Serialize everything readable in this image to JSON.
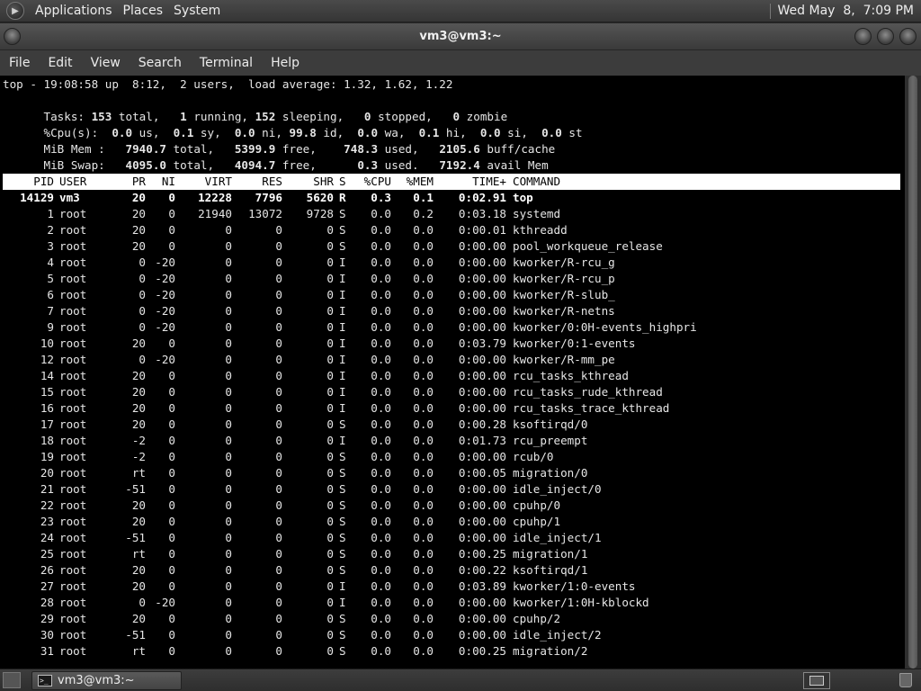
{
  "top_panel": {
    "menus": [
      "Applications",
      "Places",
      "System"
    ],
    "clock": "Wed May  8,  7:09 PM"
  },
  "window": {
    "title": "vm3@vm3:~",
    "menubar": [
      "File",
      "Edit",
      "View",
      "Search",
      "Terminal",
      "Help"
    ]
  },
  "summary": {
    "line1": "top - 19:08:58 up  8:12,  2 users,  load average: 1.32, 1.62, 1.22",
    "tasks": [
      "Tasks: ",
      "153",
      " total,   ",
      "1",
      " running, ",
      "152",
      " sleeping,   ",
      "0",
      " stopped,   ",
      "0",
      " zombie"
    ],
    "cpu": [
      "%Cpu(s):  ",
      "0.0",
      " us,  ",
      "0.1",
      " sy,  ",
      "0.0",
      " ni, ",
      "99.8",
      " id,  ",
      "0.0",
      " wa,  ",
      "0.1",
      " hi,  ",
      "0.0",
      " si,  ",
      "0.0",
      " st"
    ],
    "mem": [
      "MiB Mem :   ",
      "7940.7",
      " total,   ",
      "5399.9",
      " free,    ",
      "748.3",
      " used,   ",
      "2105.6",
      " buff/cache"
    ],
    "swap": [
      "MiB Swap:   ",
      "4095.0",
      " total,   ",
      "4094.7",
      " free,      ",
      "0.3",
      " used.   ",
      "7192.4",
      " avail Mem"
    ]
  },
  "columns": [
    "PID",
    "USER",
    "PR",
    "NI",
    "VIRT",
    "RES",
    "SHR",
    "S",
    "%CPU",
    "%MEM",
    "TIME+",
    "COMMAND"
  ],
  "processes": [
    [
      "14129",
      "vm3",
      "20",
      "0",
      "12228",
      "7796",
      "5620",
      "R",
      "0.3",
      "0.1",
      "0:02.91",
      "top"
    ],
    [
      "1",
      "root",
      "20",
      "0",
      "21940",
      "13072",
      "9728",
      "S",
      "0.0",
      "0.2",
      "0:03.18",
      "systemd"
    ],
    [
      "2",
      "root",
      "20",
      "0",
      "0",
      "0",
      "0",
      "S",
      "0.0",
      "0.0",
      "0:00.01",
      "kthreadd"
    ],
    [
      "3",
      "root",
      "20",
      "0",
      "0",
      "0",
      "0",
      "S",
      "0.0",
      "0.0",
      "0:00.00",
      "pool_workqueue_release"
    ],
    [
      "4",
      "root",
      "0",
      "-20",
      "0",
      "0",
      "0",
      "I",
      "0.0",
      "0.0",
      "0:00.00",
      "kworker/R-rcu_g"
    ],
    [
      "5",
      "root",
      "0",
      "-20",
      "0",
      "0",
      "0",
      "I",
      "0.0",
      "0.0",
      "0:00.00",
      "kworker/R-rcu_p"
    ],
    [
      "6",
      "root",
      "0",
      "-20",
      "0",
      "0",
      "0",
      "I",
      "0.0",
      "0.0",
      "0:00.00",
      "kworker/R-slub_"
    ],
    [
      "7",
      "root",
      "0",
      "-20",
      "0",
      "0",
      "0",
      "I",
      "0.0",
      "0.0",
      "0:00.00",
      "kworker/R-netns"
    ],
    [
      "9",
      "root",
      "0",
      "-20",
      "0",
      "0",
      "0",
      "I",
      "0.0",
      "0.0",
      "0:00.00",
      "kworker/0:0H-events_highpri"
    ],
    [
      "10",
      "root",
      "20",
      "0",
      "0",
      "0",
      "0",
      "I",
      "0.0",
      "0.0",
      "0:03.79",
      "kworker/0:1-events"
    ],
    [
      "12",
      "root",
      "0",
      "-20",
      "0",
      "0",
      "0",
      "I",
      "0.0",
      "0.0",
      "0:00.00",
      "kworker/R-mm_pe"
    ],
    [
      "14",
      "root",
      "20",
      "0",
      "0",
      "0",
      "0",
      "I",
      "0.0",
      "0.0",
      "0:00.00",
      "rcu_tasks_kthread"
    ],
    [
      "15",
      "root",
      "20",
      "0",
      "0",
      "0",
      "0",
      "I",
      "0.0",
      "0.0",
      "0:00.00",
      "rcu_tasks_rude_kthread"
    ],
    [
      "16",
      "root",
      "20",
      "0",
      "0",
      "0",
      "0",
      "I",
      "0.0",
      "0.0",
      "0:00.00",
      "rcu_tasks_trace_kthread"
    ],
    [
      "17",
      "root",
      "20",
      "0",
      "0",
      "0",
      "0",
      "S",
      "0.0",
      "0.0",
      "0:00.28",
      "ksoftirqd/0"
    ],
    [
      "18",
      "root",
      "-2",
      "0",
      "0",
      "0",
      "0",
      "I",
      "0.0",
      "0.0",
      "0:01.73",
      "rcu_preempt"
    ],
    [
      "19",
      "root",
      "-2",
      "0",
      "0",
      "0",
      "0",
      "S",
      "0.0",
      "0.0",
      "0:00.00",
      "rcub/0"
    ],
    [
      "20",
      "root",
      "rt",
      "0",
      "0",
      "0",
      "0",
      "S",
      "0.0",
      "0.0",
      "0:00.05",
      "migration/0"
    ],
    [
      "21",
      "root",
      "-51",
      "0",
      "0",
      "0",
      "0",
      "S",
      "0.0",
      "0.0",
      "0:00.00",
      "idle_inject/0"
    ],
    [
      "22",
      "root",
      "20",
      "0",
      "0",
      "0",
      "0",
      "S",
      "0.0",
      "0.0",
      "0:00.00",
      "cpuhp/0"
    ],
    [
      "23",
      "root",
      "20",
      "0",
      "0",
      "0",
      "0",
      "S",
      "0.0",
      "0.0",
      "0:00.00",
      "cpuhp/1"
    ],
    [
      "24",
      "root",
      "-51",
      "0",
      "0",
      "0",
      "0",
      "S",
      "0.0",
      "0.0",
      "0:00.00",
      "idle_inject/1"
    ],
    [
      "25",
      "root",
      "rt",
      "0",
      "0",
      "0",
      "0",
      "S",
      "0.0",
      "0.0",
      "0:00.25",
      "migration/1"
    ],
    [
      "26",
      "root",
      "20",
      "0",
      "0",
      "0",
      "0",
      "S",
      "0.0",
      "0.0",
      "0:00.22",
      "ksoftirqd/1"
    ],
    [
      "27",
      "root",
      "20",
      "0",
      "0",
      "0",
      "0",
      "I",
      "0.0",
      "0.0",
      "0:03.89",
      "kworker/1:0-events"
    ],
    [
      "28",
      "root",
      "0",
      "-20",
      "0",
      "0",
      "0",
      "I",
      "0.0",
      "0.0",
      "0:00.00",
      "kworker/1:0H-kblockd"
    ],
    [
      "29",
      "root",
      "20",
      "0",
      "0",
      "0",
      "0",
      "S",
      "0.0",
      "0.0",
      "0:00.00",
      "cpuhp/2"
    ],
    [
      "30",
      "root",
      "-51",
      "0",
      "0",
      "0",
      "0",
      "S",
      "0.0",
      "0.0",
      "0:00.00",
      "idle_inject/2"
    ],
    [
      "31",
      "root",
      "rt",
      "0",
      "0",
      "0",
      "0",
      "S",
      "0.0",
      "0.0",
      "0:00.25",
      "migration/2"
    ]
  ],
  "taskbar": {
    "window_button": "vm3@vm3:~"
  },
  "icons": {
    "panel_logo": "gnome-foot-icon",
    "terminal": "terminal-icon",
    "show_desktop": "show-desktop-icon",
    "workspace": "workspace-switcher-icon",
    "trash": "trash-icon"
  },
  "colors": {
    "terminal_bg": "#000000",
    "terminal_fg": "#e6e6e6",
    "header_bar": "#ffffff"
  }
}
